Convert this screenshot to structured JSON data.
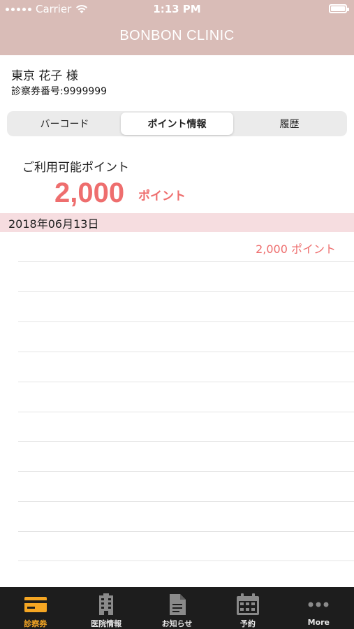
{
  "status_bar": {
    "carrier": "Carrier",
    "time": "1:13 PM"
  },
  "app": {
    "title": "BONBON CLINIC"
  },
  "patient": {
    "name": "東京 花子 様",
    "card_number": "診察券番号:9999999"
  },
  "segments": [
    {
      "label": "バーコード",
      "selected": false
    },
    {
      "label": "ポイント情報",
      "selected": true
    },
    {
      "label": "履歴",
      "selected": false
    }
  ],
  "points": {
    "label": "ご利用可能ポイント",
    "value": "2,000",
    "unit": "ポイント"
  },
  "history": {
    "date": "2018年06月13日",
    "entries": [
      {
        "text": "2,000 ポイント"
      }
    ]
  },
  "tabbar": [
    {
      "label": "診察券",
      "icon": "card-icon",
      "selected": true
    },
    {
      "label": "医院情報",
      "icon": "building-icon",
      "selected": false
    },
    {
      "label": "お知らせ",
      "icon": "document-icon",
      "selected": false
    },
    {
      "label": "予約",
      "icon": "calendar-icon",
      "selected": false
    },
    {
      "label": "More",
      "icon": "more-icon",
      "selected": false
    }
  ],
  "colors": {
    "header": "#d9bcb7",
    "accent": "#ee6e6e",
    "date_band": "#f6dde0",
    "tabbar": "#1d1d1d",
    "tab_active": "#f5a623"
  }
}
